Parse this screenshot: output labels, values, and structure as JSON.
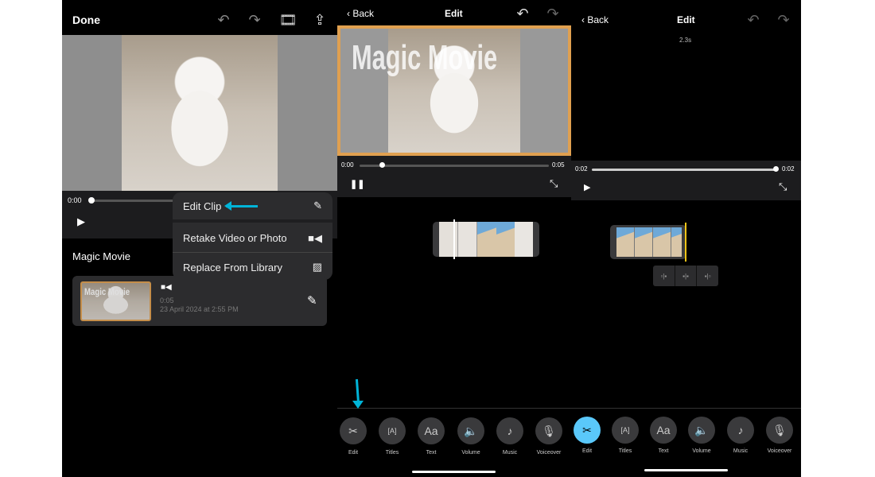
{
  "panel1": {
    "header": {
      "done_label": "Done",
      "icons": [
        "undo-icon",
        "redo-icon",
        "magic-film-icon",
        "share-icon"
      ]
    },
    "player": {
      "current_time": "0:00"
    },
    "context_menu": {
      "items": [
        {
          "label": "Edit Clip",
          "icon": "edit-square-icon"
        },
        {
          "label": "Retake Video or Photo",
          "icon": "video-camera-icon"
        },
        {
          "label": "Replace From Library",
          "icon": "photo-icon"
        }
      ]
    },
    "project_title": "Magic Movie",
    "clip": {
      "thumbnail_text": "Magic Movie",
      "duration": "0:05",
      "date": "23 April 2024 at 2:55 PM"
    }
  },
  "panel2": {
    "header": {
      "back_label": "Back",
      "title": "Edit"
    },
    "video_overlay_title": "Magic Movie",
    "player": {
      "current_time": "0:00",
      "total_time": "0:05",
      "progress": 0.1
    },
    "toolbar": [
      "Edit",
      "Titles",
      "Text",
      "Volume",
      "Music",
      "Voiceover"
    ]
  },
  "panel3": {
    "header": {
      "back_label": "Back",
      "title": "Edit"
    },
    "clip_length": "2.3s",
    "player": {
      "current_time": "0:02",
      "total_time": "0:02",
      "progress": 1.0
    },
    "toolbar": [
      "Edit",
      "Titles",
      "Text",
      "Volume",
      "Music",
      "Voiceover"
    ],
    "active_tool": "Edit"
  },
  "colors": {
    "accent_cyan": "#5ac8fa",
    "arrow": "#00b4d8",
    "clip_border": "#e0a050",
    "playhead_yellow": "#f5c518"
  }
}
